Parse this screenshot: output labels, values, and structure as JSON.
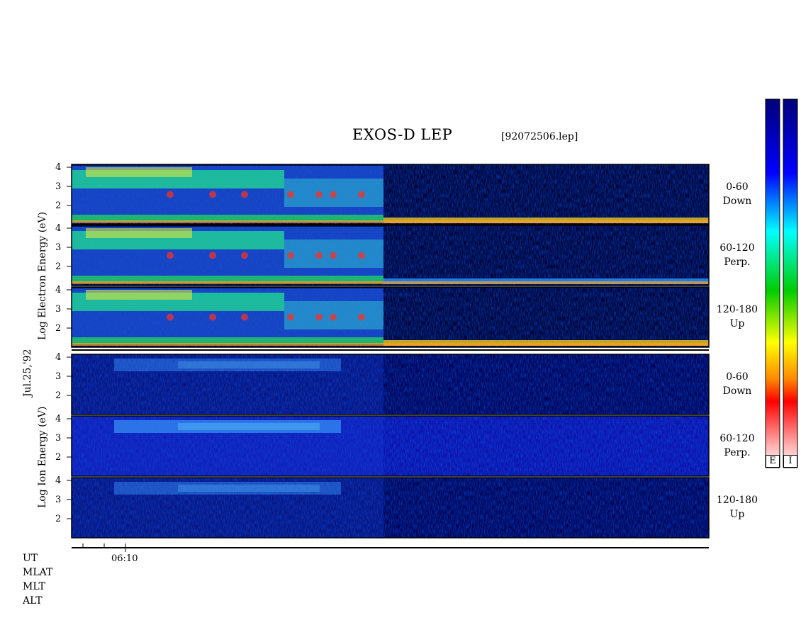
{
  "title": "EXOS-D LEP",
  "file_label": "[92072506.lep]",
  "date_label": "Jul.25,'92",
  "colorbar": {
    "labels": [
      "E",
      "I"
    ]
  },
  "row_labels": [
    "UT",
    "MLAT",
    "MLT",
    "ALT"
  ],
  "chart_data": {
    "type": "heatmap",
    "description_units": "log10 energy (eV) vs time",
    "x_tick_label": "06:10",
    "y_ticks": [
      "4",
      "3",
      "2"
    ],
    "groups": [
      {
        "species": "Electron",
        "ylabel": "Log Electron Energy (eV)",
        "panels": [
          {
            "pitch": "0-60",
            "direction": "Down"
          },
          {
            "pitch": "60-120",
            "direction": "Perp."
          },
          {
            "pitch": "120-180",
            "direction": "Up"
          }
        ]
      },
      {
        "species": "Ion",
        "ylabel": "Log Ion Energy (eV)",
        "panels": [
          {
            "pitch": "0-60",
            "direction": "Down"
          },
          {
            "pitch": "60-120",
            "direction": "Perp."
          },
          {
            "pitch": "120-180",
            "direction": "Up"
          }
        ]
      }
    ],
    "ylim": [
      1,
      4
    ]
  }
}
